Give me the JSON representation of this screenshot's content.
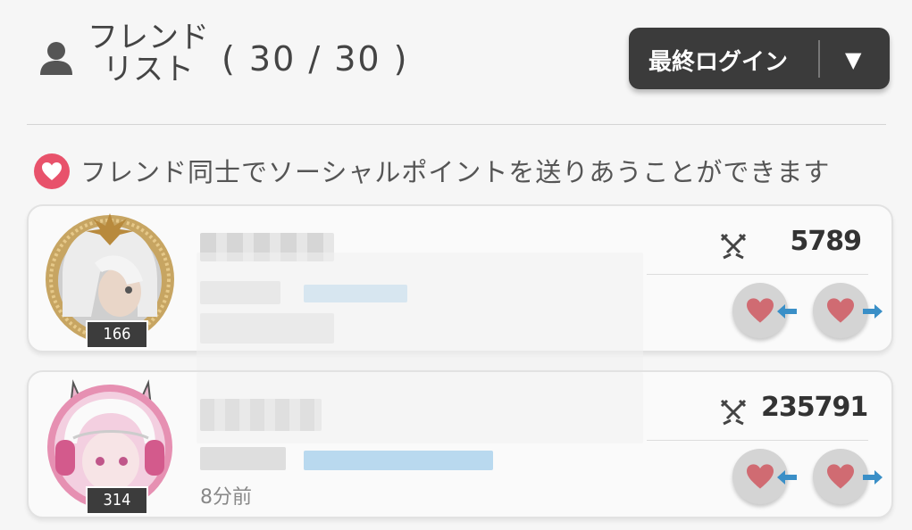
{
  "header": {
    "title_line1": "フレンド",
    "title_line2": "リスト",
    "count": "( 30 / 30 )",
    "sort_label": "最終ログイン",
    "sort_arrow": "▼"
  },
  "notice": {
    "text": "フレンド同士でソーシャルポイントを送りあうことができます",
    "icon": "heart-icon",
    "color": "#e8526b"
  },
  "friends": [
    {
      "level": "166",
      "power": "5789",
      "last_login": ""
    },
    {
      "level": "314",
      "power": "235791",
      "last_login": "8分前"
    }
  ],
  "colors": {
    "heart": "#d06b72",
    "arrow": "#3a8fc7",
    "button_dark": "#3b3b3b"
  }
}
